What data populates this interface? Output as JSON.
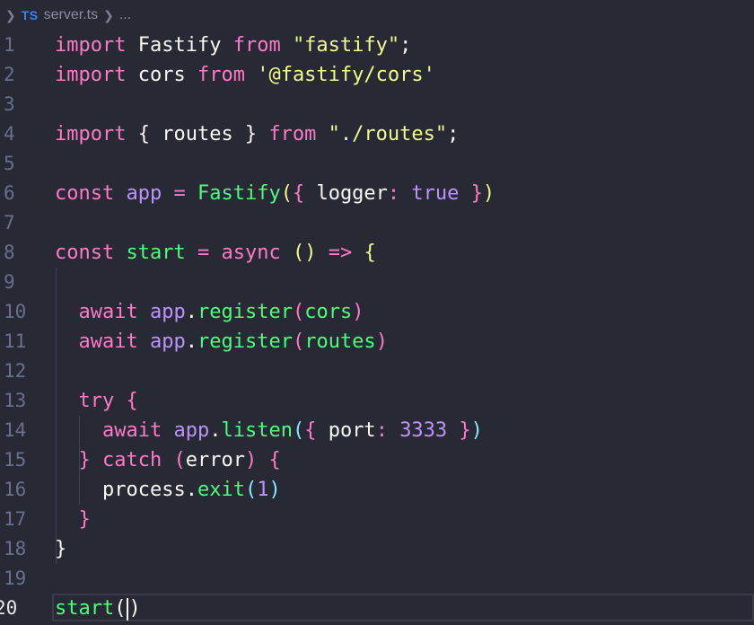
{
  "breadcrumb": {
    "language_badge": "TS",
    "file_name": "server.ts",
    "ellipsis": "..."
  },
  "editor": {
    "active_line": 20,
    "lines": [
      {
        "n": "1",
        "code": "import Fastify from \"fastify\";"
      },
      {
        "n": "2",
        "code": "import cors from '@fastify/cors'"
      },
      {
        "n": "3",
        "code": ""
      },
      {
        "n": "4",
        "code": "import { routes } from \"./routes\";"
      },
      {
        "n": "5",
        "code": ""
      },
      {
        "n": "6",
        "code": "const app = Fastify({ logger: true })"
      },
      {
        "n": "7",
        "code": ""
      },
      {
        "n": "8",
        "code": "const start = async () => {"
      },
      {
        "n": "9",
        "code": ""
      },
      {
        "n": "10",
        "code": "  await app.register(cors)"
      },
      {
        "n": "11",
        "code": "  await app.register(routes)"
      },
      {
        "n": "12",
        "code": ""
      },
      {
        "n": "13",
        "code": "  try {"
      },
      {
        "n": "14",
        "code": "    await app.listen({ port: 3333 })"
      },
      {
        "n": "15",
        "code": "  } catch (error) {"
      },
      {
        "n": "16",
        "code": "    process.exit(1)"
      },
      {
        "n": "17",
        "code": "  }"
      },
      {
        "n": "18",
        "code": "}"
      },
      {
        "n": "19",
        "code": ""
      },
      {
        "n": "20",
        "code": "start()"
      }
    ]
  }
}
